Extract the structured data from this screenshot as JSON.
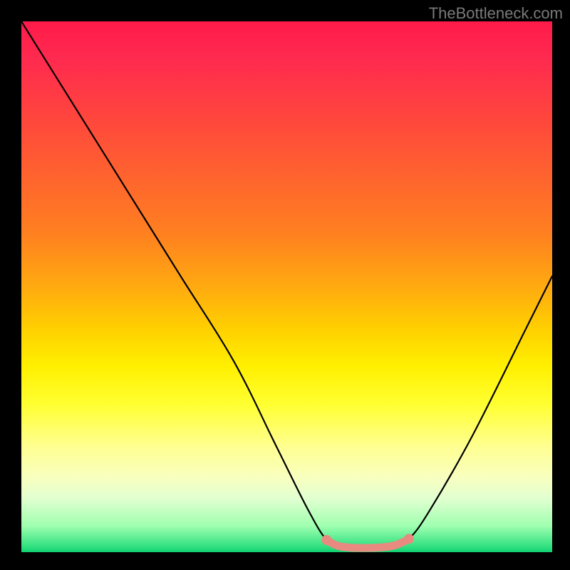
{
  "watermark": "TheBottleneck.com",
  "chart_data": {
    "type": "line",
    "title": "",
    "xlabel": "",
    "ylabel": "",
    "xlim": [
      0,
      100
    ],
    "ylim": [
      0,
      100
    ],
    "curve": {
      "name": "bottleneck-curve",
      "color": "#000000",
      "points_xy": [
        [
          0,
          100
        ],
        [
          10,
          84
        ],
        [
          20,
          68
        ],
        [
          30,
          52
        ],
        [
          40,
          36
        ],
        [
          48,
          20
        ],
        [
          54,
          8
        ],
        [
          57.5,
          2.3
        ],
        [
          60,
          1.1
        ],
        [
          65,
          0.8
        ],
        [
          70,
          1.2
        ],
        [
          73,
          2.5
        ],
        [
          77,
          8
        ],
        [
          85,
          22
        ],
        [
          95,
          42
        ],
        [
          100,
          52
        ]
      ]
    },
    "marker_segment": {
      "name": "optimal-range",
      "color": "#e88a80",
      "points_xy": [
        [
          57.5,
          2.3
        ],
        [
          60,
          1.1
        ],
        [
          65,
          0.8
        ],
        [
          70,
          1.2
        ],
        [
          73,
          2.5
        ]
      ],
      "endpoints_bold": true
    },
    "gradient_stops": [
      {
        "pos": 0,
        "color": "#ff1a4a"
      },
      {
        "pos": 50,
        "color": "#ffaa10"
      },
      {
        "pos": 72,
        "color": "#ffff30"
      },
      {
        "pos": 100,
        "color": "#10d070"
      }
    ]
  }
}
